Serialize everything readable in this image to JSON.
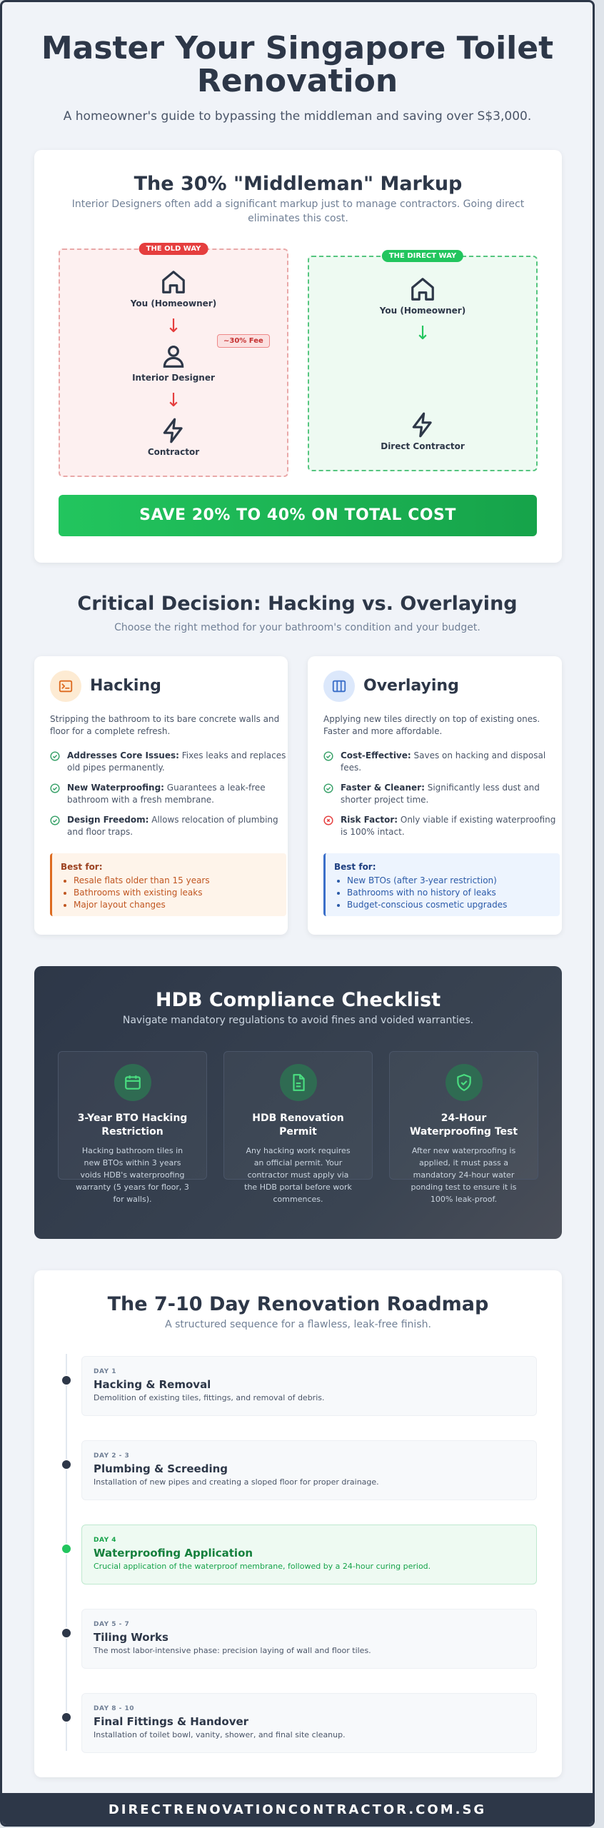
{
  "hero": {
    "title": "Master Your Singapore Toilet Renovation",
    "subtitle": "A homeowner's guide to bypassing the middleman and saving over S$3,000."
  },
  "markup": {
    "title": "The 30% \"Middleman\" Markup",
    "subtitle": "Interior Designers often add a significant markup just to manage contractors. Going direct eliminates this cost.",
    "old_way": {
      "tag": "THE OLD WAY",
      "nodes": [
        "You (Homeowner)",
        "Interior Designer",
        "Contractor"
      ],
      "fee": "~30% Fee"
    },
    "direct_way": {
      "tag": "THE DIRECT WAY",
      "nodes": [
        "You (Homeowner)",
        "Direct Contractor"
      ]
    },
    "cta": "SAVE 20% TO 40% ON TOTAL COST",
    "colors": {
      "old": "#e53e3e",
      "direct": "#22c55e"
    }
  },
  "decision": {
    "title": "Critical Decision: Hacking vs. Overlaying",
    "subtitle": "Choose the right method for your bathroom's condition and your budget.",
    "hacking": {
      "title": "Hacking",
      "icon": "terminal-icon",
      "description": "Stripping the bathroom to its bare concrete walls and floor for a complete refresh.",
      "features": [
        {
          "bold": "Addresses Core Issues:",
          "text": " Fixes leaks and replaces old pipes permanently."
        },
        {
          "bold": "New Waterproofing:",
          "text": " Guarantees a leak-free bathroom with a fresh membrane."
        },
        {
          "bold": "Design Freedom:",
          "text": " Allows relocation of plumbing and floor traps."
        }
      ],
      "best_for_title": "Best for:",
      "best_for": [
        "Resale flats older than 15 years",
        "Bathrooms with existing leaks",
        "Major layout changes"
      ]
    },
    "overlaying": {
      "title": "Overlaying",
      "icon": "columns-icon",
      "description": "Applying new tiles directly on top of existing ones. Faster and more affordable.",
      "features": [
        {
          "bold": "Cost-Effective:",
          "text": " Saves on hacking and disposal fees."
        },
        {
          "bold": "Faster & Cleaner:",
          "text": " Significantly less dust and shorter project time."
        },
        {
          "bold": "Risk Factor:",
          "text": " Only viable if existing waterproofing is 100% intact."
        }
      ],
      "best_for_title": "Best for:",
      "best_for": [
        "New BTOs (after 3-year restriction)",
        "Bathrooms with no history of leaks",
        "Budget-conscious cosmetic upgrades"
      ]
    }
  },
  "hdb": {
    "title": "HDB Compliance Checklist",
    "subtitle": "Navigate mandatory regulations to avoid fines and voided warranties.",
    "items": [
      {
        "icon": "calendar-icon",
        "title": "3-Year BTO Hacking Restriction",
        "text": "Hacking bathroom tiles in new BTOs within 3 years voids HDB's waterproofing warranty (5 years for floor, 3 for walls)."
      },
      {
        "icon": "document-icon",
        "title": "HDB Renovation Permit",
        "text": "Any hacking work requires an official permit. Your contractor must apply via the HDB portal before work commences."
      },
      {
        "icon": "shield-check-icon",
        "title": "24-Hour Waterproofing Test",
        "text": "After new waterproofing is applied, it must pass a mandatory 24-hour water ponding test to ensure it is 100% leak-proof."
      }
    ]
  },
  "roadmap": {
    "title": "The 7-10 Day Renovation Roadmap",
    "subtitle": "A structured sequence for a flawless, leak-free finish.",
    "steps": [
      {
        "day": "DAY 1",
        "title": "Hacking & Removal",
        "desc": "Demolition of existing tiles, fittings, and removal of debris."
      },
      {
        "day": "DAY 2 - 3",
        "title": "Plumbing & Screeding",
        "desc": "Installation of new pipes and creating a sloped floor for proper drainage."
      },
      {
        "day": "DAY 4",
        "title": "Waterproofing Application",
        "desc": "Crucial application of the waterproof membrane, followed by a 24-hour curing period."
      },
      {
        "day": "DAY 5 - 7",
        "title": "Tiling Works",
        "desc": "The most labor-intensive phase: precision laying of wall and floor tiles."
      },
      {
        "day": "DAY 8 - 10",
        "title": "Final Fittings & Handover",
        "desc": "Installation of toilet bowl, vanity, shower, and final site cleanup."
      }
    ],
    "highlighted_step": "DAY 4"
  },
  "footer": {
    "text": "DIRECTRENOVATIONCONTRACTOR.COM.SG"
  }
}
